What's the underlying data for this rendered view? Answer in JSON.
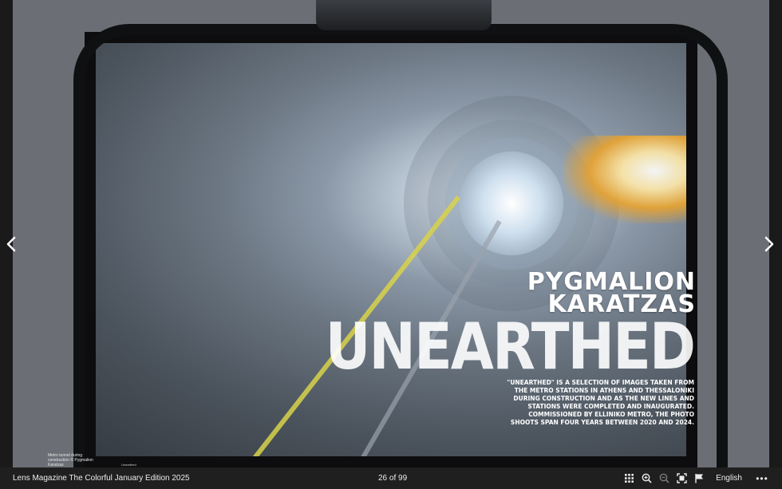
{
  "publication": {
    "document_title": "Lens Magazine The Colorful January Edition 2025",
    "page_indicator": "26 of 99",
    "language": "English"
  },
  "article": {
    "author_first": "PYGMALION",
    "author_last": "KARATZAS",
    "title": "UNEARTHED",
    "intro": "\"UNEARTHED\" IS A SELECTION OF IMAGES TAKEN FROM THE METRO STATIONS IN ATHENS AND THESSALONIKI DURING CONSTRUCTION AND AS THE NEW LINES AND STATIONS WERE COMPLETED AND INAUGURATED. COMMISSIONED BY ELLINIKO METRO, THE PHOTO SHOOTS SPAN FOUR YEARS BETWEEN 2020 AND 2024.",
    "photo_caption": "Metro tunnel during construction © Pygmalion Karatzas",
    "small_note": "Unearthed"
  },
  "toolbar": {
    "icons": [
      "grid-icon",
      "zoom-in-icon",
      "zoom-out-icon",
      "fullscreen-icon",
      "flag-icon"
    ],
    "more_label": "•••"
  },
  "colors": {
    "toolbar_bg": "#1f1f1f",
    "text": "#ececec",
    "accent_yellow": "#d8d24a"
  }
}
